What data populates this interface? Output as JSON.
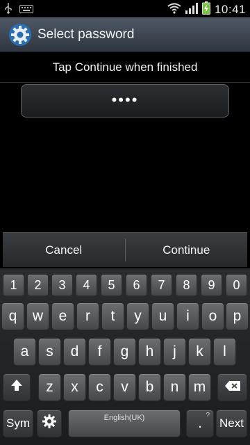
{
  "status_bar": {
    "time": "10:41",
    "icons": [
      "usb-icon",
      "keyboard-icon",
      "wifi-icon",
      "signal-icon",
      "battery-icon"
    ]
  },
  "title_bar": {
    "title": "Select password",
    "icon": "settings-gear-icon"
  },
  "prompt": "Tap Continue when finished",
  "password_field": {
    "value": "••••"
  },
  "actions": {
    "cancel": "Cancel",
    "continue": "Continue"
  },
  "keyboard": {
    "numbers": [
      "1",
      "2",
      "3",
      "4",
      "5",
      "6",
      "7",
      "8",
      "9",
      "0"
    ],
    "row1": [
      "q",
      "w",
      "e",
      "r",
      "t",
      "y",
      "u",
      "i",
      "o",
      "p"
    ],
    "row2": [
      "a",
      "s",
      "d",
      "f",
      "g",
      "h",
      "j",
      "k",
      "l"
    ],
    "row3": [
      "z",
      "x",
      "c",
      "v",
      "b",
      "n",
      "m"
    ],
    "sym": "Sym",
    "space_label": "English(UK)",
    "period_sub": "?",
    "period": ".",
    "next": "Next"
  },
  "colors": {
    "title_bar": "#3d4651",
    "battery": "#7ac142",
    "key": "#5b5e61"
  }
}
